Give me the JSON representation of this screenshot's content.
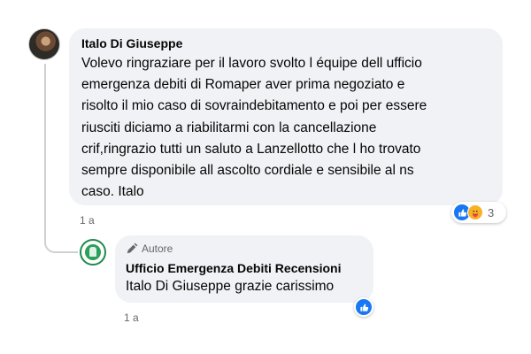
{
  "comment": {
    "author": "Italo Di Giuseppe",
    "text": "Volevo ringraziare per il lavoro svolto l équipe dell ufficio\nemergenza debiti di Romaper aver prima negoziato e\nrisolto il mio caso di sovraindebitamento e poi per essere\nriusciti diciamo a riabilitarmi con la cancellazione\ncrif,ringrazio tutti un saluto a Lanzellotto che l ho trovato\nsempre disponibile all ascolto cordiale e sensibile al ns\ncaso. Italo",
    "time": "1 a",
    "reactions": {
      "icons": [
        "like-icon",
        "care-icon"
      ],
      "count": "3"
    }
  },
  "reply": {
    "badge": "Autore",
    "author": "Ufficio Emergenza Debiti Recensioni",
    "text": "Italo Di Giuseppe grazie carissimo",
    "time": "1 a",
    "reactions": {
      "icons": [
        "like-icon"
      ]
    }
  },
  "colors": {
    "bubble": "#f0f2f5",
    "like": "#1877f2",
    "care": "#f7b125",
    "meta": "#65676b"
  }
}
